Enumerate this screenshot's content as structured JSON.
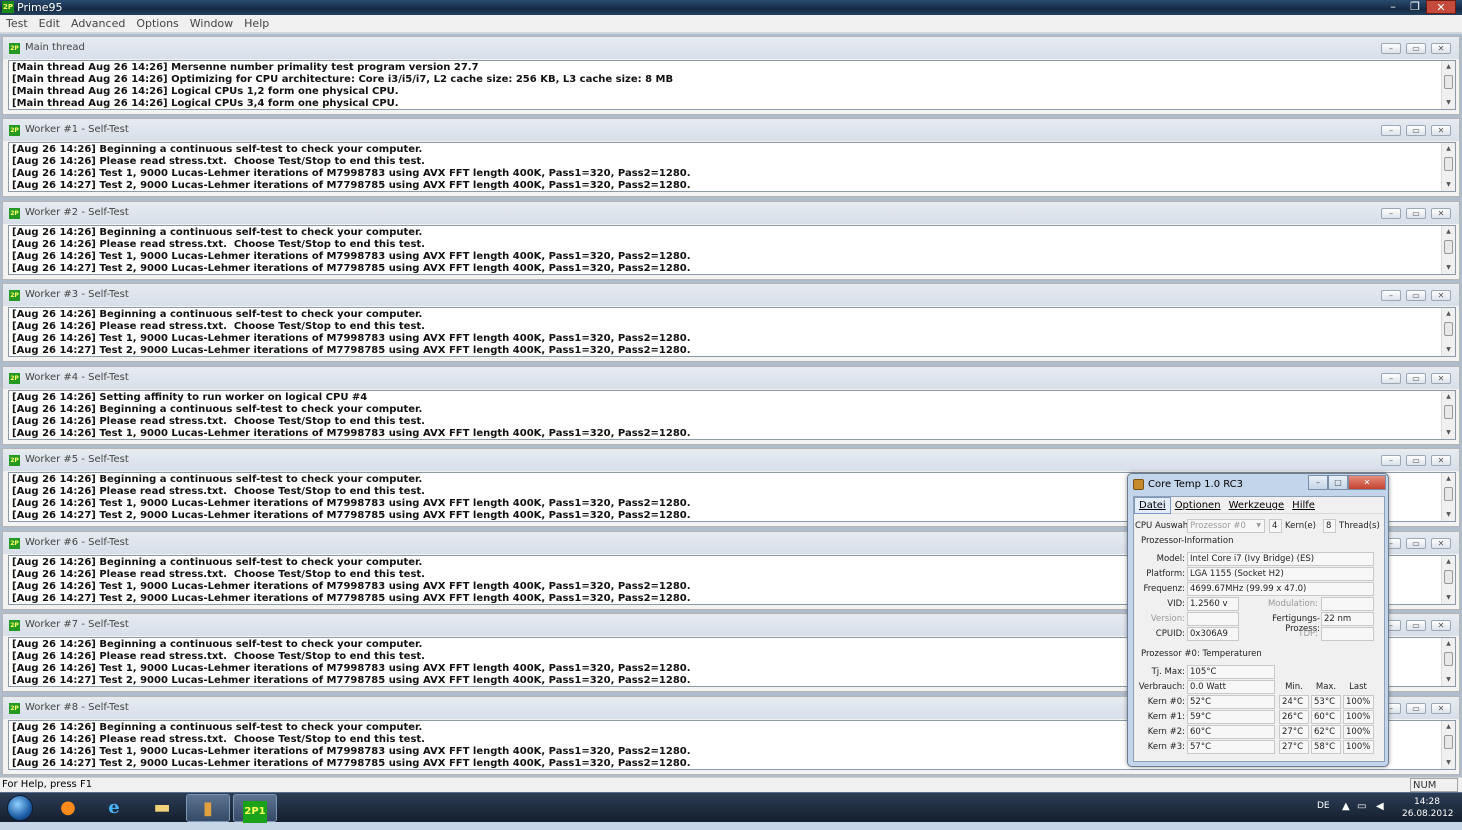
{
  "app": {
    "title": "Prime95",
    "icon": "prime95-icon"
  },
  "menu": [
    "Test",
    "Edit",
    "Advanced",
    "Options",
    "Window",
    "Help"
  ],
  "panes": [
    {
      "title": "Main thread",
      "log": [
        "[Main thread Aug 26 14:26] Mersenne number primality test program version 27.7",
        "[Main thread Aug 26 14:26] Optimizing for CPU architecture: Core i3/i5/i7, L2 cache size: 256 KB, L3 cache size: 8 MB",
        "[Main thread Aug 26 14:26] Logical CPUs 1,2 form one physical CPU.",
        "[Main thread Aug 26 14:26] Logical CPUs 3,4 form one physical CPU."
      ]
    },
    {
      "title": "Worker #1 - Self-Test",
      "log": [
        "[Aug 26 14:26] Beginning a continuous self-test to check your computer.",
        "[Aug 26 14:26] Please read stress.txt.  Choose Test/Stop to end this test.",
        "[Aug 26 14:26] Test 1, 9000 Lucas-Lehmer iterations of M7998783 using AVX FFT length 400K, Pass1=320, Pass2=1280.",
        "[Aug 26 14:27] Test 2, 9000 Lucas-Lehmer iterations of M7798785 using AVX FFT length 400K, Pass1=320, Pass2=1280."
      ]
    },
    {
      "title": "Worker #2 - Self-Test",
      "log": [
        "[Aug 26 14:26] Beginning a continuous self-test to check your computer.",
        "[Aug 26 14:26] Please read stress.txt.  Choose Test/Stop to end this test.",
        "[Aug 26 14:26] Test 1, 9000 Lucas-Lehmer iterations of M7998783 using AVX FFT length 400K, Pass1=320, Pass2=1280.",
        "[Aug 26 14:27] Test 2, 9000 Lucas-Lehmer iterations of M7798785 using AVX FFT length 400K, Pass1=320, Pass2=1280."
      ]
    },
    {
      "title": "Worker #3 - Self-Test",
      "log": [
        "[Aug 26 14:26] Beginning a continuous self-test to check your computer.",
        "[Aug 26 14:26] Please read stress.txt.  Choose Test/Stop to end this test.",
        "[Aug 26 14:26] Test 1, 9000 Lucas-Lehmer iterations of M7998783 using AVX FFT length 400K, Pass1=320, Pass2=1280.",
        "[Aug 26 14:27] Test 2, 9000 Lucas-Lehmer iterations of M7798785 using AVX FFT length 400K, Pass1=320, Pass2=1280."
      ]
    },
    {
      "title": "Worker #4 - Self-Test",
      "log": [
        "[Aug 26 14:26] Setting affinity to run worker on logical CPU #4",
        "[Aug 26 14:26] Beginning a continuous self-test to check your computer.",
        "[Aug 26 14:26] Please read stress.txt.  Choose Test/Stop to end this test.",
        "[Aug 26 14:26] Test 1, 9000 Lucas-Lehmer iterations of M7998783 using AVX FFT length 400K, Pass1=320, Pass2=1280."
      ]
    },
    {
      "title": "Worker #5 - Self-Test",
      "log": [
        "[Aug 26 14:26] Beginning a continuous self-test to check your computer.",
        "[Aug 26 14:26] Please read stress.txt.  Choose Test/Stop to end this test.",
        "[Aug 26 14:26] Test 1, 9000 Lucas-Lehmer iterations of M7998783 using AVX FFT length 400K, Pass1=320, Pass2=1280.",
        "[Aug 26 14:27] Test 2, 9000 Lucas-Lehmer iterations of M7798785 using AVX FFT length 400K, Pass1=320, Pass2=1280."
      ]
    },
    {
      "title": "Worker #6 - Self-Test",
      "log": [
        "[Aug 26 14:26] Beginning a continuous self-test to check your computer.",
        "[Aug 26 14:26] Please read stress.txt.  Choose Test/Stop to end this test.",
        "[Aug 26 14:26] Test 1, 9000 Lucas-Lehmer iterations of M7998783 using AVX FFT length 400K, Pass1=320, Pass2=1280.",
        "[Aug 26 14:27] Test 2, 9000 Lucas-Lehmer iterations of M7798785 using AVX FFT length 400K, Pass1=320, Pass2=1280."
      ]
    },
    {
      "title": "Worker #7 - Self-Test",
      "log": [
        "[Aug 26 14:26] Beginning a continuous self-test to check your computer.",
        "[Aug 26 14:26] Please read stress.txt.  Choose Test/Stop to end this test.",
        "[Aug 26 14:26] Test 1, 9000 Lucas-Lehmer iterations of M7998783 using AVX FFT length 400K, Pass1=320, Pass2=1280.",
        "[Aug 26 14:27] Test 2, 9000 Lucas-Lehmer iterations of M7798785 using AVX FFT length 400K, Pass1=320, Pass2=1280."
      ]
    },
    {
      "title": "Worker #8 - Self-Test",
      "log": [
        "[Aug 26 14:26] Beginning a continuous self-test to check your computer.",
        "[Aug 26 14:26] Please read stress.txt.  Choose Test/Stop to end this test.",
        "[Aug 26 14:26] Test 1, 9000 Lucas-Lehmer iterations of M7998783 using AVX FFT length 400K, Pass1=320, Pass2=1280.",
        "[Aug 26 14:27] Test 2, 9000 Lucas-Lehmer iterations of M7798785 using AVX FFT length 400K, Pass1=320, Pass2=1280."
      ]
    }
  ],
  "status": {
    "help": "For Help, press F1",
    "num": "NUM"
  },
  "coretemp": {
    "title": "Core Temp 1.0 RC3",
    "menu": [
      "Datei",
      "Optionen",
      "Werkzeuge",
      "Hilfe"
    ],
    "cpu_select_label": "CPU Auswahl:",
    "cpu_select_value": "Prozessor #0",
    "cores": "4",
    "cores_label": "Kern(e)",
    "threads": "8",
    "threads_label": "Thread(s)",
    "info_group": "Prozessor-Information",
    "model_label": "Model:",
    "model": "Intel Core i7 (Ivy Bridge)  (ES)",
    "platform_label": "Platform:",
    "platform": "LGA 1155 (Socket H2)",
    "freq_label": "Frequenz:",
    "freq": "4699.67MHz (99.99 x 47.0)",
    "vid_label": "VID:",
    "vid": "1.2560 v",
    "modulation_label": "Modulation:",
    "version_label": "Version:",
    "process_label": "Fertigungs-Prozess:",
    "process": "22 nm",
    "cpuid_label": "CPUID:",
    "cpuid": "0x306A9",
    "tdp_label": "TDP:",
    "temp_group": "Prozessor #0: Temperaturen",
    "tjmax_label": "Tj. Max:",
    "tjmax": "105°C",
    "power_label": "Verbrauch:",
    "power": "0.0 Watt",
    "col_min": "Min.",
    "col_max": "Max.",
    "col_load": "Last",
    "cores_list": [
      {
        "label": "Kern #0:",
        "temp": "52°C",
        "min": "24°C",
        "max": "53°C",
        "load": "100%"
      },
      {
        "label": "Kern #1:",
        "temp": "59°C",
        "min": "26°C",
        "max": "60°C",
        "load": "100%"
      },
      {
        "label": "Kern #2:",
        "temp": "60°C",
        "min": "27°C",
        "max": "62°C",
        "load": "100%"
      },
      {
        "label": "Kern #3:",
        "temp": "57°C",
        "min": "27°C",
        "max": "58°C",
        "load": "100%"
      }
    ]
  },
  "taskbar": {
    "items": [
      "start-orb-icon",
      "firefox-icon",
      "internet-explorer-icon",
      "explorer-folder-icon",
      "coretemp-icon",
      "prime95-icon"
    ],
    "lang": "DE",
    "time": "14:28",
    "date": "26.08.2012"
  }
}
